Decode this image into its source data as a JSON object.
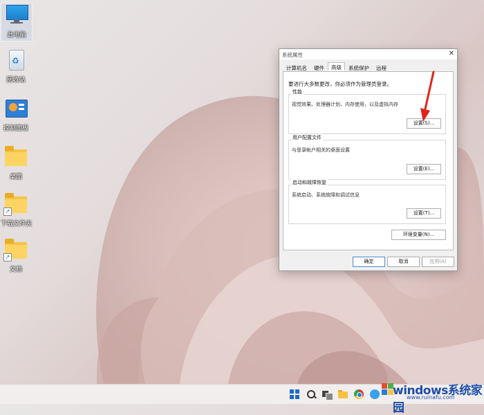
{
  "desktop": {
    "icons": [
      {
        "label": "此电脑",
        "icon": "monitor-icon"
      },
      {
        "label": "回收站",
        "icon": "recycle-bin-icon"
      },
      {
        "label": "控制面板",
        "icon": "control-panel-icon"
      },
      {
        "label": "桌面",
        "icon": "folder-icon"
      },
      {
        "label": "下载文件夹",
        "icon": "folder-shortcut-icon"
      },
      {
        "label": "文档",
        "icon": "folder-shortcut-icon"
      }
    ]
  },
  "dialog": {
    "title": "系统属性",
    "tabs": [
      "计算机名",
      "硬件",
      "高级",
      "系统保护",
      "远程"
    ],
    "active_tab": "高级",
    "note": "要进行大多数更改，你必须作为管理员登录。",
    "performance": {
      "title": "性能",
      "desc": "视觉效果、处理器计划、内存使用，以及虚拟内存",
      "button": "设置(S)..."
    },
    "user_profiles": {
      "title": "用户配置文件",
      "desc": "与登录帐户相关的桌面设置",
      "button": "设置(E)..."
    },
    "startup": {
      "title": "启动和故障恢复",
      "desc": "系统启动、系统故障和调试信息",
      "button": "设置(T)..."
    },
    "env_button": "环境变量(N)...",
    "ok": "确定",
    "cancel": "取消",
    "apply": "应用(A)"
  },
  "watermark": {
    "text": "windows系统家园",
    "sub": "www.ruinafu.com"
  },
  "colors": {
    "accent": "#1a6ac8",
    "arrow": "#e0241b"
  }
}
